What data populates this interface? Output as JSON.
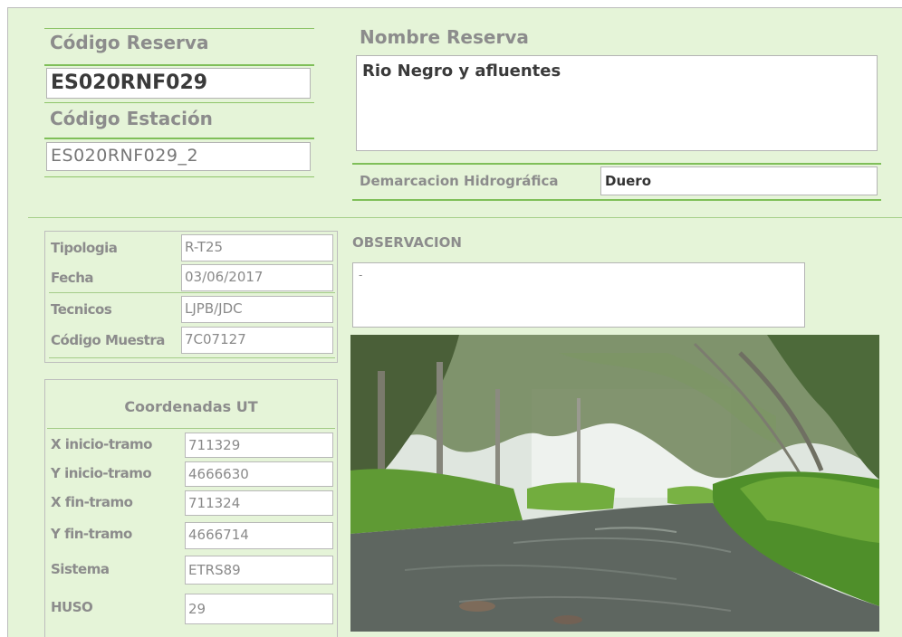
{
  "header": {
    "codigo_reserva_label": "Código Reserva",
    "codigo_reserva_value": "ES020RNF029",
    "codigo_estacion_label": "Código Estación",
    "codigo_estacion_value": "ES020RNF029_2",
    "nombre_reserva_label": "Nombre Reserva",
    "nombre_reserva_value": "Rio Negro y afluentes",
    "demarcacion_label": "Demarcacion Hidrográfica",
    "demarcacion_value": "Duero"
  },
  "info_table": [
    {
      "label": "Tipologia",
      "value": "R-T25"
    },
    {
      "label": "Fecha",
      "value": "03/06/2017"
    },
    {
      "label": "Tecnicos",
      "value": "LJPB/JDC"
    },
    {
      "label": "Código Muestra",
      "value": "7C07127"
    }
  ],
  "coordenadas": {
    "title": "Coordenadas UT",
    "rows": [
      {
        "label": "X inicio-tramo",
        "value": "711329"
      },
      {
        "label": "Y inicio-tramo",
        "value": "4666630"
      },
      {
        "label": "X fin-tramo",
        "value": "711324"
      },
      {
        "label": "Y fin-tramo",
        "value": "4666714"
      },
      {
        "label": "Sistema",
        "value": "ETRS89"
      },
      {
        "label": "HUSO",
        "value": "29"
      }
    ]
  },
  "observacion": {
    "label": "OBSERVACION",
    "value": "-"
  },
  "photo": {
    "icon": "river-photo",
    "colors": {
      "water": "#5f6660",
      "grass": "#6aa23c",
      "trees": "#56703f",
      "sky": "#e6ece7"
    }
  }
}
